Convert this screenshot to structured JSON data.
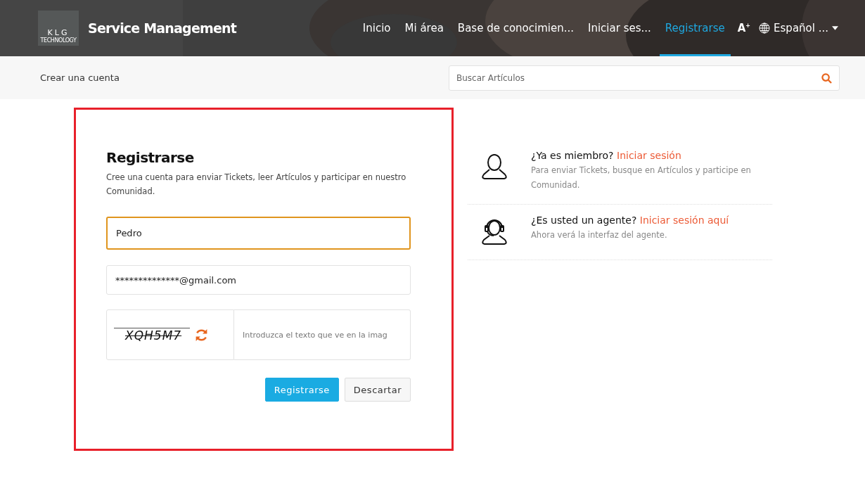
{
  "header": {
    "logo": {
      "letters": "KLG",
      "sub": "TECHNOLOGY"
    },
    "title": "Service Management",
    "nav": [
      {
        "label": "Inicio",
        "selected": false
      },
      {
        "label": "Mi área",
        "selected": false
      },
      {
        "label": "Base de conocimien...",
        "selected": false
      },
      {
        "label": "Iniciar ses...",
        "selected": false
      },
      {
        "label": "Registrarse",
        "selected": true
      }
    ],
    "font_size_button": {
      "letter": "A",
      "mark": "+"
    },
    "language": "Español ..."
  },
  "subbar": {
    "breadcrumb": "Crear una cuenta",
    "search": {
      "placeholder": "Buscar Artículos"
    }
  },
  "form": {
    "title": "Registrarse",
    "description": "Cree una cuenta para enviar Tickets, leer Artículos y participar en nuestro Comunidad.",
    "fields": [
      {
        "value": "Pedro",
        "focused": true
      },
      {
        "value": "**************@gmail.com",
        "focused": false
      }
    ],
    "captcha": {
      "text": "XQH5M7",
      "placeholder": "Introduzca el texto que ve en la imag"
    },
    "buttons": [
      {
        "label": "Registrarse",
        "kind": "primary"
      },
      {
        "label": "Descartar",
        "kind": "secondary"
      }
    ]
  },
  "side": [
    {
      "kind": "member",
      "question": "¿Ya es miembro?",
      "link": "Iniciar sesión",
      "note": "Para enviar Tickets, busque en Artículos y participe en Comunidad."
    },
    {
      "kind": "agent",
      "question": "¿Es usted un agente?",
      "link": "Iniciar sesión aquí",
      "note": "Ahora verá la interfaz del agente."
    }
  ]
}
